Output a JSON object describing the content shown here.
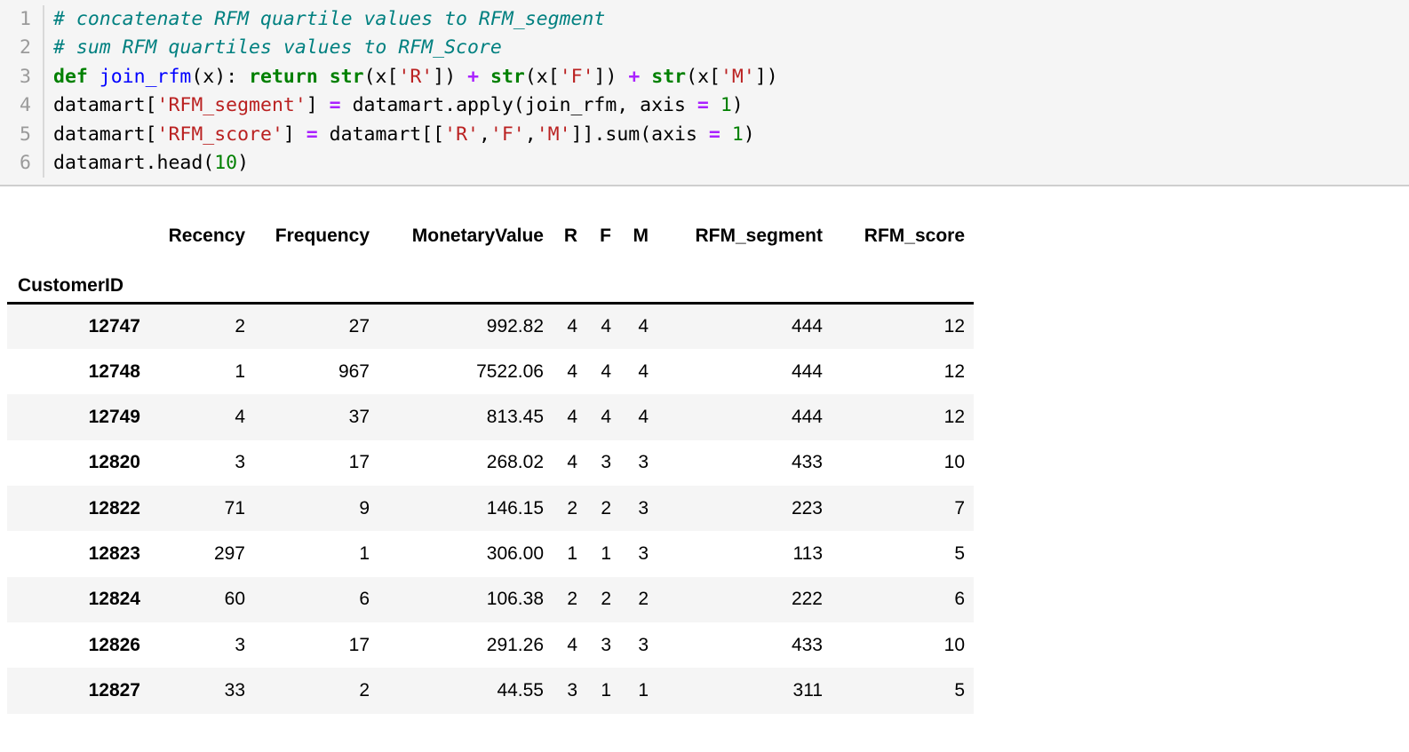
{
  "code_cell": {
    "line_numbers": [
      "1",
      "2",
      "3",
      "4",
      "5",
      "6"
    ],
    "lines": [
      {
        "number": "1",
        "tokens": [
          {
            "t": "comment",
            "s": "# concatenate RFM quartile values to RFM_segment"
          }
        ]
      },
      {
        "number": "2",
        "tokens": [
          {
            "t": "comment",
            "s": "# sum RFM quartiles values to RFM_Score"
          }
        ]
      },
      {
        "number": "3",
        "tokens": [
          {
            "t": "keyword",
            "s": "def"
          },
          {
            "t": "plain",
            "s": " "
          },
          {
            "t": "fn",
            "s": "join_rfm"
          },
          {
            "t": "plain",
            "s": "(x): "
          },
          {
            "t": "keyword",
            "s": "return"
          },
          {
            "t": "plain",
            "s": " "
          },
          {
            "t": "fn2",
            "s": "str"
          },
          {
            "t": "plain",
            "s": "(x["
          },
          {
            "t": "str",
            "s": "'R'"
          },
          {
            "t": "plain",
            "s": "]) "
          },
          {
            "t": "op",
            "s": "+"
          },
          {
            "t": "plain",
            "s": " "
          },
          {
            "t": "fn2",
            "s": "str"
          },
          {
            "t": "plain",
            "s": "(x["
          },
          {
            "t": "str",
            "s": "'F'"
          },
          {
            "t": "plain",
            "s": "]) "
          },
          {
            "t": "op",
            "s": "+"
          },
          {
            "t": "plain",
            "s": " "
          },
          {
            "t": "fn2",
            "s": "str"
          },
          {
            "t": "plain",
            "s": "(x["
          },
          {
            "t": "str",
            "s": "'M'"
          },
          {
            "t": "plain",
            "s": "])"
          }
        ]
      },
      {
        "number": "4",
        "tokens": [
          {
            "t": "plain",
            "s": "datamart["
          },
          {
            "t": "str",
            "s": "'RFM_segment'"
          },
          {
            "t": "plain",
            "s": "] "
          },
          {
            "t": "op",
            "s": "="
          },
          {
            "t": "plain",
            "s": " datamart.apply(join_rfm, axis "
          },
          {
            "t": "op",
            "s": "="
          },
          {
            "t": "plain",
            "s": " "
          },
          {
            "t": "num",
            "s": "1"
          },
          {
            "t": "plain",
            "s": ")"
          }
        ]
      },
      {
        "number": "5",
        "tokens": [
          {
            "t": "plain",
            "s": "datamart["
          },
          {
            "t": "str",
            "s": "'RFM_score'"
          },
          {
            "t": "plain",
            "s": "] "
          },
          {
            "t": "op",
            "s": "="
          },
          {
            "t": "plain",
            "s": " datamart[["
          },
          {
            "t": "str",
            "s": "'R'"
          },
          {
            "t": "plain",
            "s": ","
          },
          {
            "t": "str",
            "s": "'F'"
          },
          {
            "t": "plain",
            "s": ","
          },
          {
            "t": "str",
            "s": "'M'"
          },
          {
            "t": "plain",
            "s": "]].sum(axis "
          },
          {
            "t": "op",
            "s": "="
          },
          {
            "t": "plain",
            "s": " "
          },
          {
            "t": "num",
            "s": "1"
          },
          {
            "t": "plain",
            "s": ")"
          }
        ]
      },
      {
        "number": "6",
        "tokens": [
          {
            "t": "plain",
            "s": "datamart.head("
          },
          {
            "t": "num",
            "s": "10"
          },
          {
            "t": "plain",
            "s": ")"
          }
        ]
      }
    ],
    "colors": {
      "background": "#f5f5f5",
      "comment": "#008080",
      "keyword": "#008000",
      "function": "#0000ff",
      "string": "#ba2121",
      "operator": "#aa22ff",
      "number": "#008000",
      "line_number": "#9a9a9a"
    }
  },
  "dataframe": {
    "index_name": "CustomerID",
    "columns": [
      "Recency",
      "Frequency",
      "MonetaryValue",
      "R",
      "F",
      "M",
      "RFM_segment",
      "RFM_score"
    ],
    "rows": [
      {
        "index": "12747",
        "cells": [
          "2",
          "27",
          "992.82",
          "4",
          "4",
          "4",
          "444",
          "12"
        ]
      },
      {
        "index": "12748",
        "cells": [
          "1",
          "967",
          "7522.06",
          "4",
          "4",
          "4",
          "444",
          "12"
        ]
      },
      {
        "index": "12749",
        "cells": [
          "4",
          "37",
          "813.45",
          "4",
          "4",
          "4",
          "444",
          "12"
        ]
      },
      {
        "index": "12820",
        "cells": [
          "3",
          "17",
          "268.02",
          "4",
          "3",
          "3",
          "433",
          "10"
        ]
      },
      {
        "index": "12822",
        "cells": [
          "71",
          "9",
          "146.15",
          "2",
          "2",
          "3",
          "223",
          "7"
        ]
      },
      {
        "index": "12823",
        "cells": [
          "297",
          "1",
          "306.00",
          "1",
          "1",
          "3",
          "113",
          "5"
        ]
      },
      {
        "index": "12824",
        "cells": [
          "60",
          "6",
          "106.38",
          "2",
          "2",
          "2",
          "222",
          "6"
        ]
      },
      {
        "index": "12826",
        "cells": [
          "3",
          "17",
          "291.26",
          "4",
          "3",
          "3",
          "433",
          "10"
        ]
      },
      {
        "index": "12827",
        "cells": [
          "33",
          "2",
          "44.55",
          "3",
          "1",
          "1",
          "311",
          "5"
        ]
      }
    ],
    "colors": {
      "stripe": "#f5f5f5",
      "plain": "#ffffff",
      "header_rule": "#000000"
    }
  }
}
